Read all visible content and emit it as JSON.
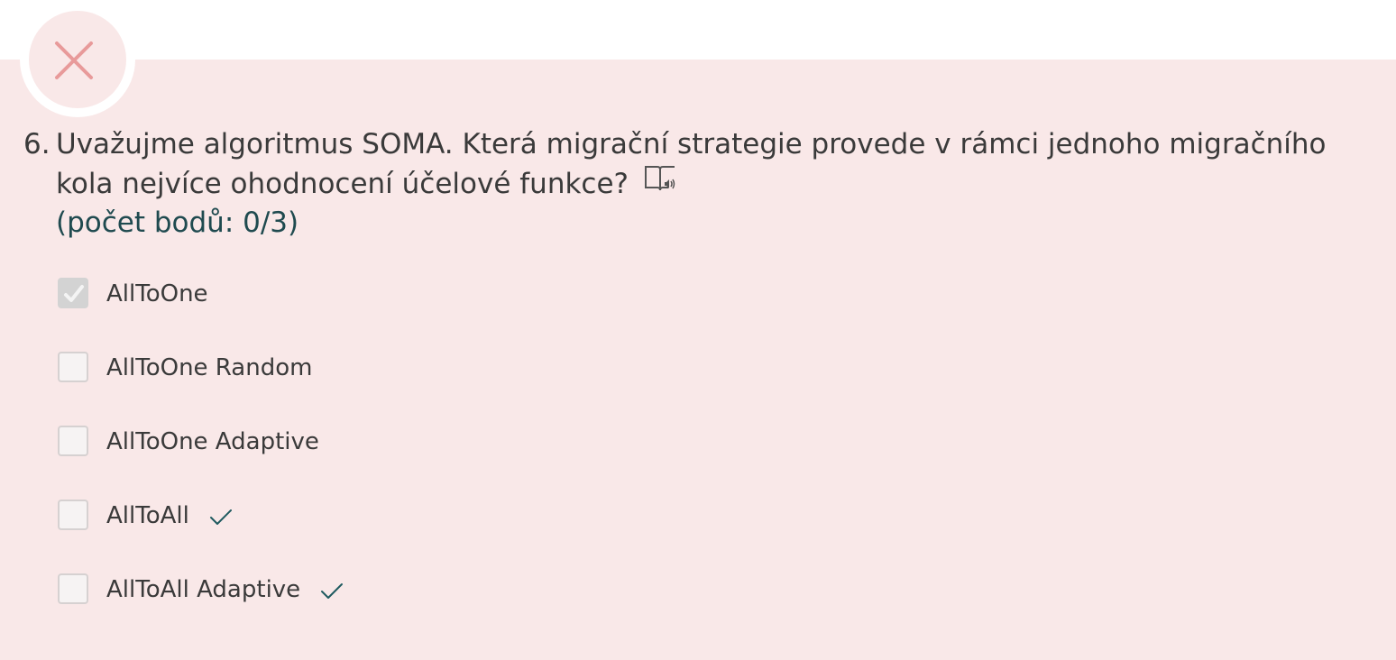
{
  "question": {
    "number": "6.",
    "text": "Uvažujme algoritmus SOMA. Která migrační strategie provede v rámci jednoho migračního kola nejvíce ohodnocení účelové funkce?",
    "points": "(počet bodů: 0/3)",
    "status": "incorrect",
    "status_icon": "x-icon",
    "read_aloud_icon": "read-aloud-icon"
  },
  "options": [
    {
      "label": "AllToOne",
      "checked": true,
      "correct_mark": false
    },
    {
      "label": "AllToOne Random",
      "checked": false,
      "correct_mark": false
    },
    {
      "label": "AllToOne Adaptive",
      "checked": false,
      "correct_mark": false
    },
    {
      "label": "AllToAll",
      "checked": false,
      "correct_mark": true
    },
    {
      "label": "AllToAll Adaptive",
      "checked": false,
      "correct_mark": true
    }
  ],
  "colors": {
    "panel_background": "#f9e8e8",
    "incorrect_icon": "#e89a9a",
    "points_text": "#1f4a4f",
    "correct_mark": "#1f5a5f"
  }
}
